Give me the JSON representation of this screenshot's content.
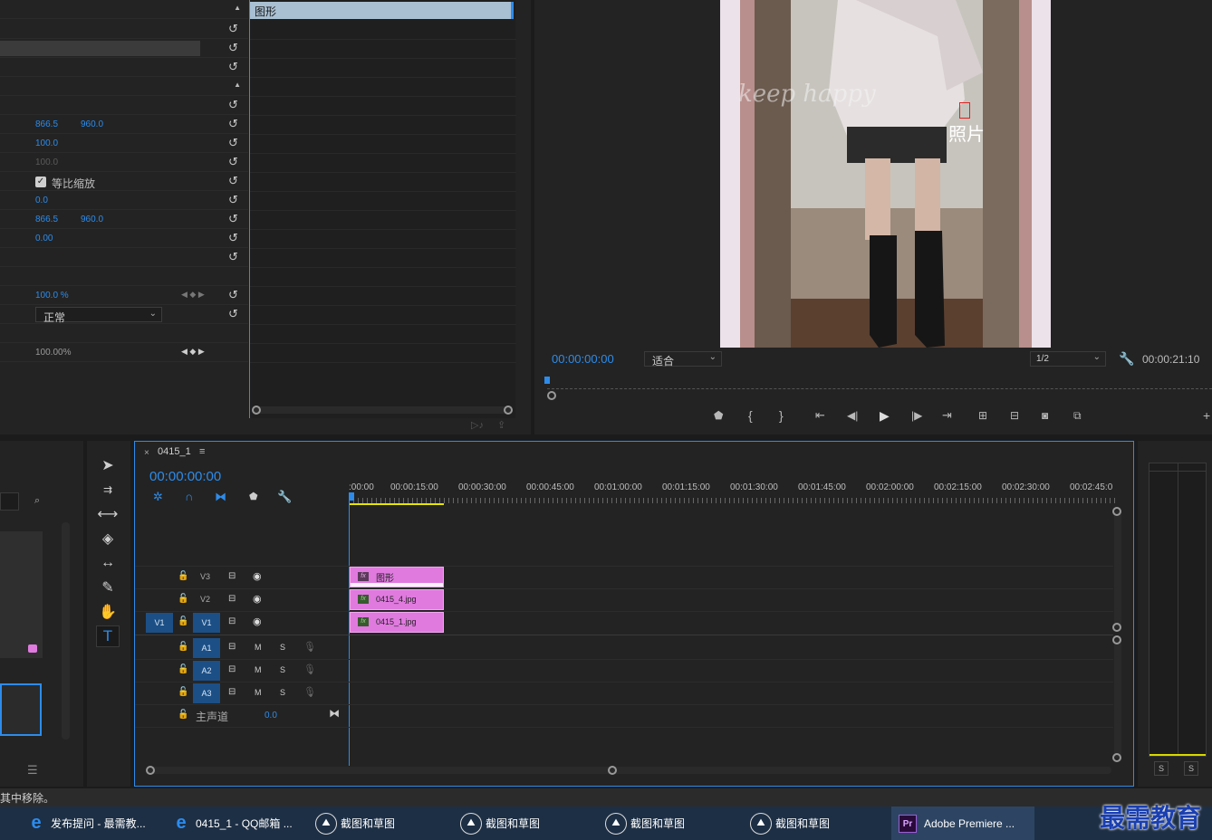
{
  "effect_controls": {
    "clip_header": "图形",
    "rows": [
      {
        "v1": "",
        "v2": ""
      },
      {
        "v1": "866.5",
        "v2": "960.0"
      },
      {
        "v1": "100.0",
        "v2": ""
      },
      {
        "v1": "100.0",
        "v2": ""
      },
      {
        "checkbox_label": "等比缩放"
      },
      {
        "v1": "0.0",
        "v2": ""
      },
      {
        "v1": "866.5",
        "v2": "960.0"
      },
      {
        "v1": "0.00",
        "v2": ""
      }
    ],
    "opacity": "100.0 %",
    "blend_mode": "正常",
    "time_remap": "100.00%"
  },
  "program_monitor": {
    "timecode": "00:00:00:00",
    "fit": "适合",
    "resolution": "1/2",
    "duration": "00:00:21:10",
    "overlay_text": "照片",
    "watermark_text": "keep happy"
  },
  "timeline": {
    "sequence_name": "0415_1",
    "timecode": "00:00:00:00",
    "ruler": [
      ":00:00",
      "00:00:15:00",
      "00:00:30:00",
      "00:00:45:00",
      "00:01:00:00",
      "00:01:15:00",
      "00:01:30:00",
      "00:01:45:00",
      "00:02:00:00",
      "00:02:15:00",
      "00:02:30:00",
      "00:02:45:0"
    ],
    "video_tracks": [
      {
        "name": "V3",
        "clip": "图形"
      },
      {
        "name": "V2",
        "clip": "0415_4.jpg"
      },
      {
        "name": "V1",
        "clip": "0415_1.jpg",
        "source": "V1"
      }
    ],
    "audio_tracks": [
      {
        "name": "A1",
        "m": "M",
        "s": "S"
      },
      {
        "name": "A2",
        "m": "M",
        "s": "S"
      },
      {
        "name": "A3",
        "m": "M",
        "s": "S"
      }
    ],
    "master": {
      "label": "主声道",
      "value": "0.0"
    }
  },
  "meters": {
    "s1": "S",
    "s2": "S"
  },
  "status_text": "其中移除。",
  "taskbar": [
    {
      "label": "发布提问 - 最需教...",
      "icon": "ie-icon"
    },
    {
      "label": "0415_1 - QQ邮箱 ...",
      "icon": "ie-icon"
    },
    {
      "label": "截图和草图",
      "icon": "snip-icon"
    },
    {
      "label": "截图和草图",
      "icon": "snip-icon"
    },
    {
      "label": "截图和草图",
      "icon": "snip-icon"
    },
    {
      "label": "截图和草图",
      "icon": "snip-icon"
    },
    {
      "label": "Adobe Premiere ...",
      "icon": "premiere-icon"
    }
  ],
  "brand_watermark": "最需教育",
  "colors": {
    "accent": "#2d8ceb",
    "clip": "#e07adf",
    "track_active": "#1c4f86"
  }
}
